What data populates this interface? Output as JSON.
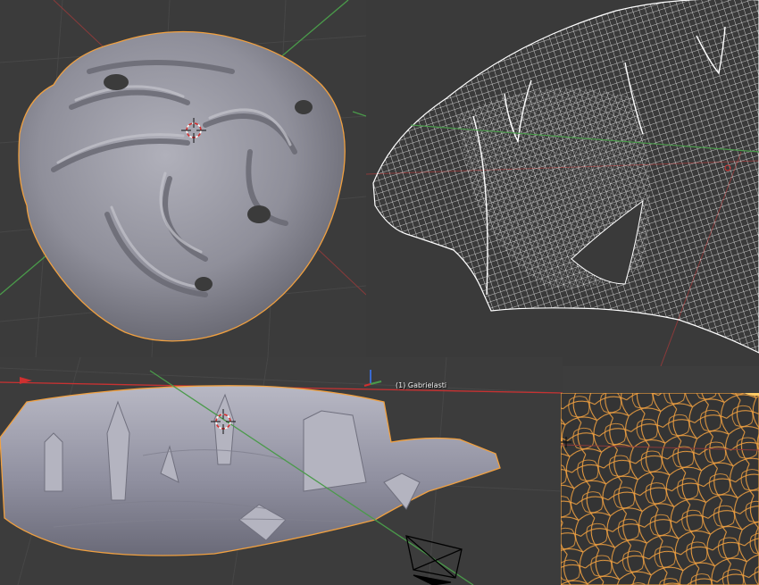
{
  "viewport": {
    "object_label": "(1) Gabrielasti"
  },
  "colors": {
    "background": "#3d3d3d",
    "grid": "#474747",
    "selection_outline": "#f0a040",
    "mesh_surface": "#9a9aa4",
    "wireframe": "#ffffff",
    "axis_x": "#c83232",
    "axis_y": "#4a9a4a",
    "axis_z": "#3a6ad0"
  },
  "icons": [
    "3d-cursor-icon",
    "camera-icon",
    "axis-gizmo-icon"
  ]
}
